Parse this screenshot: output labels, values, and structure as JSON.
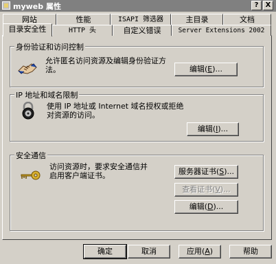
{
  "window": {
    "title": "myweb 属性",
    "help_button": "?",
    "close_button": "X"
  },
  "tabs": {
    "row_back": [
      "网站",
      "性能",
      "ISAPI 筛选器",
      "主目录",
      "文档"
    ],
    "row_front": [
      "目录安全性",
      "HTTP 头",
      "自定义错误",
      "Server Extensions 2002"
    ],
    "active": "目录安全性"
  },
  "auth_group": {
    "title": "身份验证和访问控制",
    "description": "允许匿名访问资源及编辑身份验证方法。",
    "edit_button": {
      "label": "编辑",
      "hotkey": "E"
    },
    "icon": "handshake-icon"
  },
  "ip_group": {
    "title": "IP 地址和域名限制",
    "description": "使用 IP 地址或 Internet 域名授权或拒绝对资源的访问。",
    "edit_button": {
      "label": "编辑",
      "hotkey": "I"
    },
    "icon": "lock-icon"
  },
  "secure_group": {
    "title": "安全通信",
    "description": "访问资源时，要求安全通信并启用客户端证书。",
    "server_cert_button": {
      "label": "服务器证书",
      "hotkey": "S"
    },
    "view_cert_button": {
      "label": "查看证书",
      "hotkey": "V",
      "disabled": true
    },
    "edit_button": {
      "label": "编辑",
      "hotkey": "D"
    },
    "icon": "key-icon"
  },
  "footer": {
    "ok": "确定",
    "cancel": "取消",
    "apply": {
      "label": "应用",
      "hotkey": "A"
    },
    "help": "帮助"
  }
}
